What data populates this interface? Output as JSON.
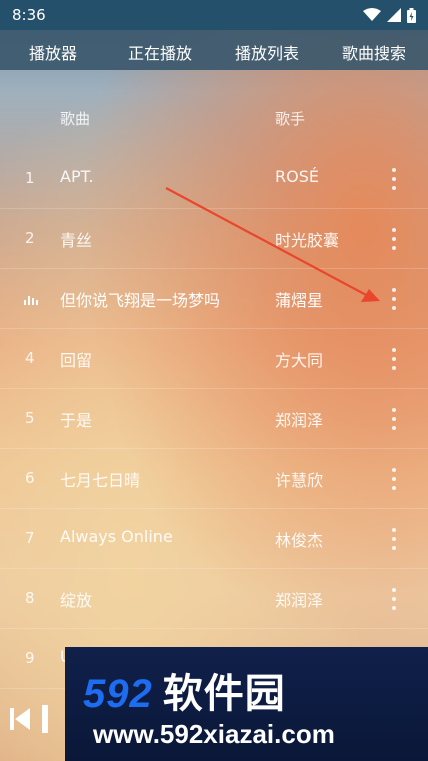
{
  "status_bar": {
    "time": "8:36"
  },
  "tabs": [
    "播放器",
    "正在播放",
    "播放列表",
    "歌曲搜索"
  ],
  "header": {
    "song_col": "歌曲",
    "artist_col": "歌手"
  },
  "songs": [
    {
      "num": "1",
      "title": "APT.",
      "artist": "ROSÉ",
      "playing": false
    },
    {
      "num": "2",
      "title": "青丝",
      "artist": "时光胶囊",
      "playing": false
    },
    {
      "num": "",
      "title": "但你说飞翔是一场梦吗",
      "artist": "蒲熠星",
      "playing": true
    },
    {
      "num": "4",
      "title": "回留",
      "artist": "方大同",
      "playing": false
    },
    {
      "num": "5",
      "title": "于是",
      "artist": "郑润泽",
      "playing": false
    },
    {
      "num": "6",
      "title": "七月七日晴",
      "artist": "许慧欣",
      "playing": false
    },
    {
      "num": "7",
      "title": "Always Online",
      "artist": "林俊杰",
      "playing": false
    },
    {
      "num": "8",
      "title": "绽放",
      "artist": "郑润泽",
      "playing": false
    },
    {
      "num": "9",
      "title": "U",
      "artist": "",
      "playing": false
    }
  ],
  "watermark": {
    "brand_num": "592",
    "brand_cn": "软件园",
    "url": "www.592xiazai.com"
  },
  "colors": {
    "status_bar": "#25506b",
    "arrow": "#e8472e",
    "watermark_blue": "#1e6cf0"
  }
}
